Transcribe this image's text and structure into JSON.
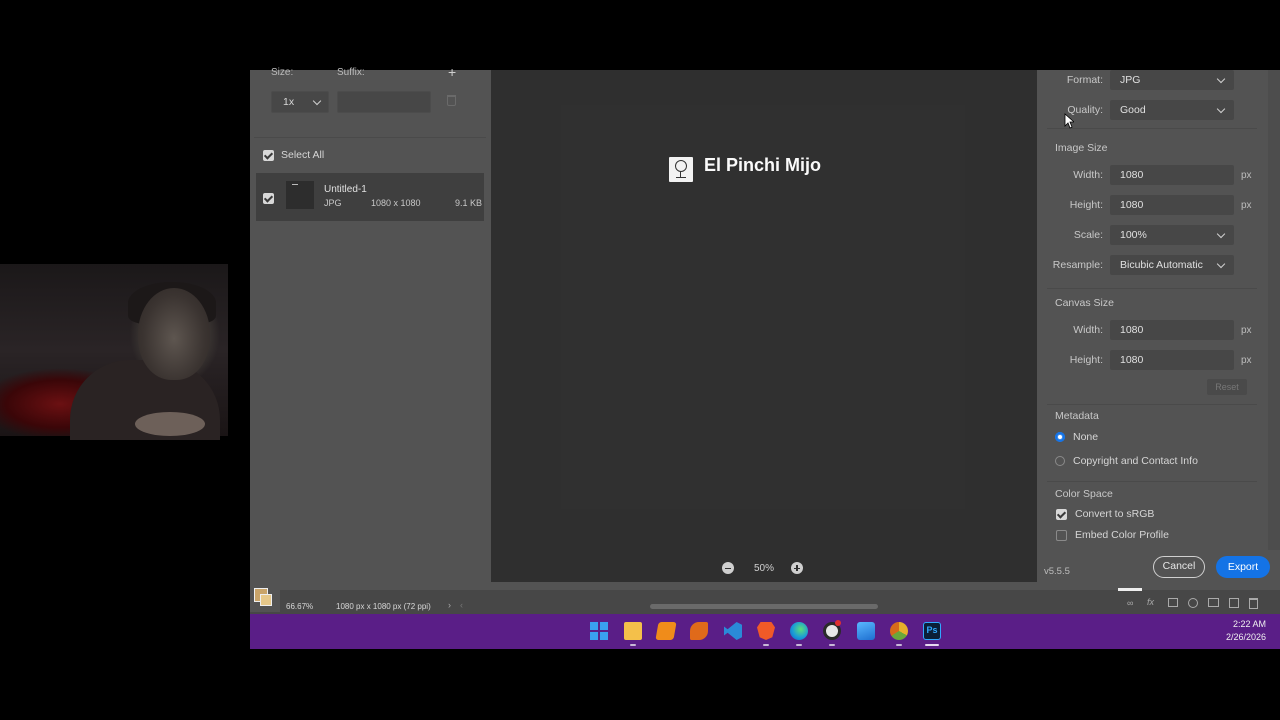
{
  "left_panel": {
    "size_label": "Size:",
    "suffix_label": "Suffix:",
    "size_value": "1x",
    "suffix_placeholder": "",
    "select_all_label": "Select All",
    "asset": {
      "name": "Untitled-1",
      "format": "JPG",
      "dimensions": "1080 x 1080",
      "filesize": "9.1 KB"
    }
  },
  "preview": {
    "art_title": "El Pinchi Mijo",
    "zoom_value": "50%"
  },
  "right_panel": {
    "format_label": "Format:",
    "format_value": "JPG",
    "quality_label": "Quality:",
    "quality_value": "Good",
    "image_size_heading": "Image Size",
    "width_label": "Width:",
    "width_value": "1080",
    "height_label": "Height:",
    "height_value": "1080",
    "unit": "px",
    "scale_label": "Scale:",
    "scale_value": "100%",
    "resample_label": "Resample:",
    "resample_value": "Bicubic Automatic",
    "canvas_size_heading": "Canvas Size",
    "canvas_width_label": "Width:",
    "canvas_width_value": "1080",
    "canvas_height_label": "Height:",
    "canvas_height_value": "1080",
    "reset_label": "Reset",
    "metadata_heading": "Metadata",
    "metadata_none": "None",
    "metadata_copyright": "Copyright and Contact Info",
    "color_space_heading": "Color Space",
    "convert_srgb": "Convert to sRGB",
    "embed_profile": "Embed Color Profile",
    "version": "v5.5.5",
    "cancel_label": "Cancel",
    "export_label": "Export"
  },
  "ps_status": {
    "zoom": "66.67%",
    "doc_info": "1080 px x 1080 px (72 ppi)"
  },
  "taskbar": {
    "time": "2:22 AM",
    "date": "2/26/2026",
    "icons": [
      "windows-start-icon",
      "file-explorer-icon",
      "sublime-text-icon",
      "fl-studio-icon",
      "vscode-icon",
      "brave-browser-icon",
      "edge-browser-icon",
      "obs-studio-icon",
      "photos-icon",
      "chrome-canary-icon",
      "photoshop-icon"
    ]
  },
  "colors": {
    "accent_blue": "#1473e6",
    "taskbar_purple": "#5a1e87",
    "panel_gray": "#535353",
    "preview_gray": "#2f2f2f"
  }
}
